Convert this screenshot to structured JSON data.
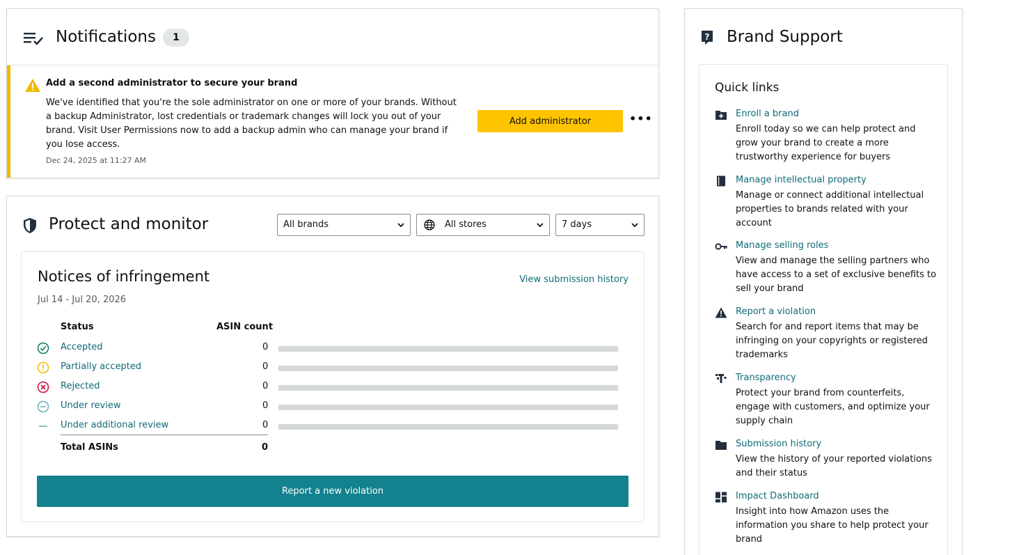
{
  "notifications": {
    "title": "Notifications",
    "count": "1",
    "alert": {
      "title": "Add a second administrator to secure your brand",
      "body": "We've identified that you're the sole administrator on one or more of your brands. Without a backup Administrator, lost credentials or trademark changes will lock you out of your brand. Visit User Permissions now to add a backup admin who can manage your brand if you lose access.",
      "timestamp": "Dec 24, 2025 at 11:27 AM",
      "button_label": "Add administrator",
      "more_label": "•••",
      "accent_color": "#f0b800"
    }
  },
  "protect": {
    "title": "Protect and monitor",
    "filters": {
      "brands": "All brands",
      "stores": "All stores",
      "days": "7 days"
    },
    "notices": {
      "title": "Notices of infringement",
      "date_range": "Jul 14 - Jul 20, 2026",
      "view_history_label": "View submission history",
      "col_status": "Status",
      "col_count": "ASIN count",
      "rows": [
        {
          "label": "Accepted",
          "count": "0",
          "icon": "check-circle-icon",
          "color": "#067d62",
          "fill": 0
        },
        {
          "label": "Partially accepted",
          "count": "0",
          "icon": "exclamation-circle-icon",
          "color": "#f0b800",
          "fill": 0
        },
        {
          "label": "Rejected",
          "count": "0",
          "icon": "x-circle-icon",
          "color": "#cc0c39",
          "fill": 0
        },
        {
          "label": "Under review",
          "count": "0",
          "icon": "minus-circle-icon",
          "color": "#6ab0b3",
          "fill": 0
        },
        {
          "label": "Under additional review",
          "count": "0",
          "icon": "dash-icon",
          "color": "#6ab0b3",
          "fill": 0
        }
      ],
      "total_label": "Total ASINs",
      "total_value": "0",
      "report_button": "Report a new violation"
    }
  },
  "support": {
    "title": "Brand Support",
    "quick_links_title": "Quick links",
    "items": [
      {
        "label": "Enroll a brand",
        "desc": "Enroll today so we can help protect and grow your brand to create a more trustworthy experience for buyers",
        "icon": "folder-plus-icon"
      },
      {
        "label": "Manage intellectual property",
        "desc": "Manage or connect additional intellectual properties to brands related with your account",
        "icon": "book-icon"
      },
      {
        "label": "Manage selling roles",
        "desc": "View and manage the selling partners who have access to a set of exclusive benefits to sell your brand",
        "icon": "key-icon"
      },
      {
        "label": "Report a violation",
        "desc": "Search for and report items that may be infringing on your copyrights or registered trademarks",
        "icon": "warning-icon"
      },
      {
        "label": "Transparency",
        "desc": "Protect your brand from counterfeits, engage with customers, and optimize your supply chain",
        "icon": "transparency-icon"
      },
      {
        "label": "Submission history",
        "desc": "View the history of your reported violations and their status",
        "icon": "folder-icon"
      },
      {
        "label": "Impact Dashboard",
        "desc": "Insight into how Amazon uses the information you share to help protect your brand",
        "icon": "dashboard-icon"
      }
    ]
  },
  "colors": {
    "link": "#0f6b79",
    "primary_button": "#13818e",
    "yellow_button": "#ffc400"
  }
}
